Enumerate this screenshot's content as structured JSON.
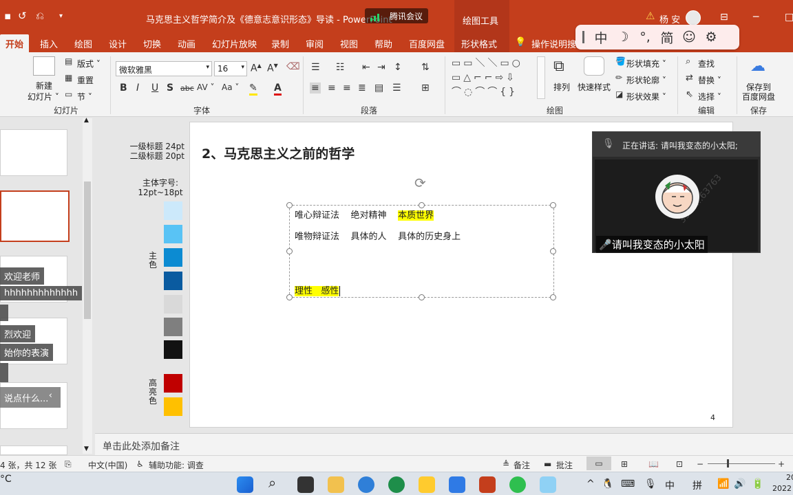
{
  "window": {
    "title": "马克思主义哲学简介及《德意志意识形态》导读 - PowerPoint",
    "context_tab_group": "绘图工具",
    "user_name": "杨 安",
    "undo_icon": "undo-icon",
    "redo_icon": "redo-icon"
  },
  "meeting": {
    "app_name": "腾讯会议",
    "speaking_label": "正在讲话: 请叫我变态的小太阳;",
    "participant_name": "请叫我变态的小太阳",
    "watermark": "3519…63763"
  },
  "ime": {
    "items": [
      "中",
      "☽",
      "°,",
      "简",
      "☺",
      "⚙"
    ]
  },
  "ribbon_tabs": [
    "开始",
    "插入",
    "绘图",
    "设计",
    "切换",
    "动画",
    "幻灯片放映",
    "录制",
    "审阅",
    "视图",
    "帮助",
    "百度网盘",
    "形状格式",
    "操作说明搜索"
  ],
  "ribbon": {
    "slides": {
      "new_slide": "新建",
      "new_slide2": "幻灯片 ˅",
      "layout": "版式 ˅",
      "reset": "重置",
      "section": "节 ˅",
      "label": "幻灯片"
    },
    "font": {
      "name": "微软雅黑",
      "size": "16",
      "label": "字体"
    },
    "paragraph": {
      "label": "段落"
    },
    "drawing": {
      "arrange": "排列",
      "quick_styles": "快速样式",
      "shape_fill": "形状填充 ˅",
      "shape_outline": "形状轮廓 ˅",
      "shape_effects": "形状效果 ˅",
      "label": "绘图"
    },
    "editing": {
      "find": "查找",
      "replace": "替换 ˅",
      "select": "选择 ˅",
      "label": "编辑"
    },
    "save": {
      "save_to": "保存到",
      "baidu": "百度网盘",
      "label": "保存"
    }
  },
  "chat_messages": [
    "欢迎老师",
    "hhhhhhhhhhhhh",
    "烈欢迎",
    "始你的表演",
    "说点什么..."
  ],
  "guide": {
    "heading_sizes": "一级标题 24pt\n二级标题 20pt",
    "body_size": "主体字号:\n12pt~18pt",
    "main_color_label": "主\n色",
    "highlight_label": "高\n亮\n色",
    "main_colors": [
      "#cce9fb",
      "#59c3f5",
      "#0c8bd2",
      "#0a5ba0",
      "#d9d9d9",
      "#7f7f7f",
      "#121212"
    ],
    "highlight_colors": [
      "#c00000",
      "#ffc000"
    ]
  },
  "slide": {
    "title": "2、马克思主义之前的哲学",
    "line1": {
      "a": "唯心辩证法",
      "b": "绝对精神",
      "c": "本质世界"
    },
    "line2": {
      "a": "唯物辩证法",
      "b": "具体的人",
      "c": "具体的历史身上"
    },
    "line3": {
      "a": "理性",
      "b": "感性"
    },
    "page_number": "4"
  },
  "notes_placeholder": "单击此处添加备注",
  "status": {
    "slide_count": "4 张，共 12 张",
    "language": "中文(中国)",
    "accessibility": "辅助功能: 调查",
    "notes": "备注",
    "comments": "批注"
  },
  "taskbar": {
    "temp": "°C",
    "ime_mode": "中",
    "ime_pinyin": "拼",
    "clock_line1": "20",
    "clock_line2": "2022"
  },
  "colors": {
    "accent": "#c43e1c",
    "highlight": "#ffff00"
  }
}
